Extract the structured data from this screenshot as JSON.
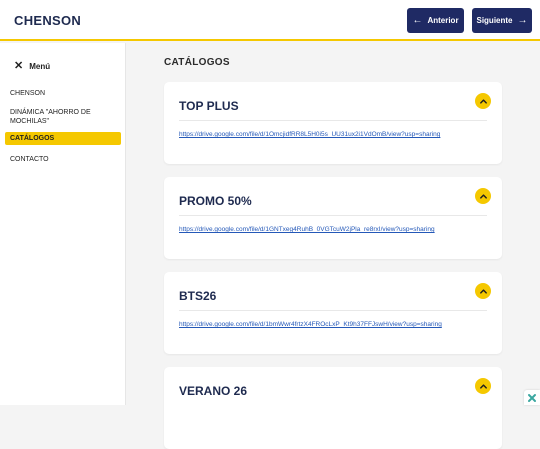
{
  "header": {
    "brand": "CHENSON",
    "prev_label": "Anterior",
    "next_label": "Siguiente"
  },
  "sidebar": {
    "menu_label": "Menú",
    "items": [
      {
        "label": "CHENSON",
        "active": false
      },
      {
        "label": "DINÁMICA \"AHORRO DE MOCHILAS\"",
        "active": false
      },
      {
        "label": "CATÁLOGOS",
        "active": true
      },
      {
        "label": "CONTACTO",
        "active": false
      }
    ]
  },
  "main": {
    "section_title": "CATÁLOGOS",
    "cards": [
      {
        "title": "TOP PLUS",
        "link": "https://drive.google.com/file/d/1OmcjidfRR8L5H0i5s_UU31ux2i1VdOmB/view?usp=sharing"
      },
      {
        "title": "PROMO 50%",
        "link": "https://drive.google.com/file/d/1GNTxeg4RuhB_0VGTcuW2jPla_re8rxI/view?usp=sharing"
      },
      {
        "title": "BTS26",
        "link": "https://drive.google.com/file/d/1bmWwr4frtzX4FROcLxP_Kt9h37FFJswH/view?usp=sharing"
      },
      {
        "title": "VERANO 26",
        "link": ""
      }
    ]
  },
  "colors": {
    "accent": "#f5c800",
    "brand_navy": "#1f2a64",
    "link": "#2458b8"
  },
  "icons": {
    "prev": "arrow-left-icon",
    "next": "arrow-right-icon",
    "menu": "close-icon",
    "card": "chevron-up-icon",
    "corner": "x-logo-icon"
  }
}
